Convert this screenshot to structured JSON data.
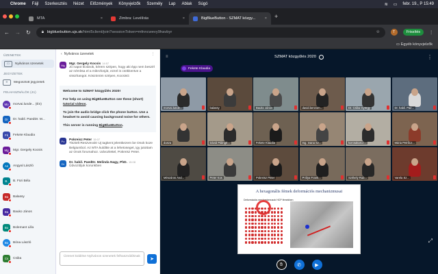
{
  "menubar": {
    "app": "Chrome",
    "items": [
      "Fájl",
      "Szerkesztés",
      "Nézet",
      "Előzmények",
      "Könyvjelzők",
      "Személy",
      "Lap",
      "Ablak",
      "Súgó"
    ],
    "datetime": "febr. 19., P 15:49"
  },
  "tabs": [
    {
      "label": "MTA",
      "fav_color": "#888888"
    },
    {
      "label": "Zimbra: Levélírás",
      "fav_color": "#e53935"
    },
    {
      "label": "BigBlueButton - SZMAT közgy...",
      "fav_color": "#3f6bd8"
    }
  ],
  "urlbar": {
    "domain": "bigbluebutton.ujs.sk",
    "path": "/html5client/join?sessionToken=mfnncwevy9havbyr",
    "profile_initial": "T",
    "status_button": "Frissítés"
  },
  "bookmarks": {
    "other": "Egyéb könyvjelzők"
  },
  "users_panel": {
    "messages_section": "ÜZENETEK",
    "public_chat": "Nyilvános üzenetek",
    "notes_section": "JEGYZETEK",
    "shared_notes": "Megosztott jegyzetek",
    "users_section": "FELHASZNÁLÓK (41)",
    "users": [
      {
        "initials": "Mo",
        "name": "morvai.lunde... (Én)",
        "color": "#5e35b1"
      },
      {
        "initials": "Dr",
        "name": "Dr. habil. PaedDr. M...",
        "color": "#1565c0"
      },
      {
        "initials": "Fk",
        "name": "Fekete Klaudia",
        "color": "#3949ab"
      },
      {
        "initials": "Mg",
        "name": "Mgr. Gergely Kocsis",
        "color": "#6a1b9a"
      },
      {
        "initials": "An",
        "name": "Angyal László",
        "color": "#0277bd"
      },
      {
        "initials": "B.",
        "name": "B. Füri Béla",
        "color": "#00838f"
      },
      {
        "initials": "Ba",
        "name": "Balassy",
        "color": "#c62828"
      },
      {
        "initials": "Ba",
        "name": "Bauko János",
        "color": "#4527a0"
      },
      {
        "initials": "Bo",
        "name": "Bolemant Lilla",
        "color": "#00897b"
      },
      {
        "initials": "Bo",
        "name": "Bóna László",
        "color": "#1e88e5"
      },
      {
        "initials": "Cs",
        "name": "Csiba",
        "color": "#2e7d32"
      }
    ]
  },
  "chat": {
    "header": "Nyilvános üzenetek",
    "messages": [
      {
        "initials": "Mg",
        "color": "#6a1b9a",
        "author": "Mgr. Gergely Kocsis",
        "time": "14:57",
        "text": "Jó napot kívánok, kérem szépen, hogy aki épp nem beszél az némítsa el a mikrofonját, ezzel is csökkentve a visszhangot. Köszönöm szépen, KocsisG"
      }
    ],
    "welcome": {
      "line1": "Welcome to SZMAT közgyűlés 2020!",
      "line2a": "For help on using BigBlueButton see these (short) ",
      "line2link": "tutorial videos",
      "line2b": ".",
      "line3": "To join the audio bridge click the phone button. Use a headset to avoid causing background noise for others.",
      "line4a": "This server is running ",
      "line4link": "BigBlueButton",
      "line4b": "."
    },
    "messages2": [
      {
        "initials": "Po",
        "color": "#283593",
        "author": "Pokreisz Peter",
        "time": "15:07",
        "text": "Tisztelt Reszvevok! Uj tagkent jelentkezem be Onok koze Belgiumbol. Az MTA kulditte at a lehetoseget, igy jutottam az Onok forumahoz. Udvozlettel, Pokreisz Peter."
      },
      {
        "initials": "Dr",
        "color": "#1565c0",
        "author": "Dr. habil. PaedDr. Melinda Nagy, PhD.",
        "time": "15:08",
        "text": "Üdvozöljuk korunkben"
      }
    ],
    "input_placeholder": "Üzenet küldése Nyilvános üzenetek felhasználóknak"
  },
  "meeting": {
    "title": "SZMAT közgyűlés 2020",
    "talking": "Fekete Klaudia",
    "tiles": [
      {
        "name": "morvai.lunde...",
        "bg": "#8e9aa6",
        "shirt": "#2a2a2a"
      },
      {
        "name": "balassy",
        "bg": "#5b4a3c",
        "shirt": "#3b3b3b"
      },
      {
        "name": "Bauko János",
        "bg": "#7f8c8d",
        "shirt": "#4b4b4b"
      },
      {
        "name": "david.benzom...",
        "bg": "#6d5b4c",
        "shirt": "#222222"
      },
      {
        "name": "Dr. Csiba György",
        "bg": "#9aa6ae",
        "shirt": "#333333"
      },
      {
        "name": "Dr. habil. Pae...",
        "bg": "#5d6d7e",
        "shirt": "#d9d9d9"
      },
      {
        "name": "dusza",
        "bg": "#8a7a66",
        "shirt": "#333333"
      },
      {
        "name": "Dávid Pálingé...",
        "bg": "#a49a8a",
        "shirt": "#2b2b2b"
      },
      {
        "name": "Fekete Klaudia",
        "bg": "#6e6152",
        "shirt": "#1b1b1b"
      },
      {
        "name": "Ing. Ivana Sz...",
        "bg": "#968674",
        "shirt": "#444444"
      },
      {
        "name": "korcsakarcz...",
        "bg": "#b3aea3",
        "shirt": "#2c2c2c"
      },
      {
        "name": "Mária Petrőcz...",
        "bg": "#7d6450",
        "shirt": "#8c3b2a"
      },
      {
        "name": "Mészáros And...",
        "bg": "#4e4a43",
        "shirt": "#222222"
      },
      {
        "name": "Peter Kos",
        "bg": "#8d8d86",
        "shirt": "#3a3a3a"
      },
      {
        "name": "Pokreisz Peter",
        "bg": "#5d4b3d",
        "shirt": "#1a1a1a"
      },
      {
        "name": "Prólya Frank...",
        "bg": "#786a5b",
        "shirt": "#1f1f1f"
      },
      {
        "name": "Székely Rub...",
        "bg": "#7b6d5f",
        "shirt": "#272727"
      },
      {
        "name": "Varela Sz...",
        "bg": "#6d3b2d",
        "shirt": "#a31c1c"
      }
    ],
    "presentation_title": "A hexagonális fémek deformációs mechanizmusai",
    "presentation_subtitle": "Deformációs mechanizmusok HCP fémekben",
    "colors": {
      "mute": "#1a1a1a",
      "audio": "#0f70d7",
      "video": "#0f70d7"
    }
  }
}
